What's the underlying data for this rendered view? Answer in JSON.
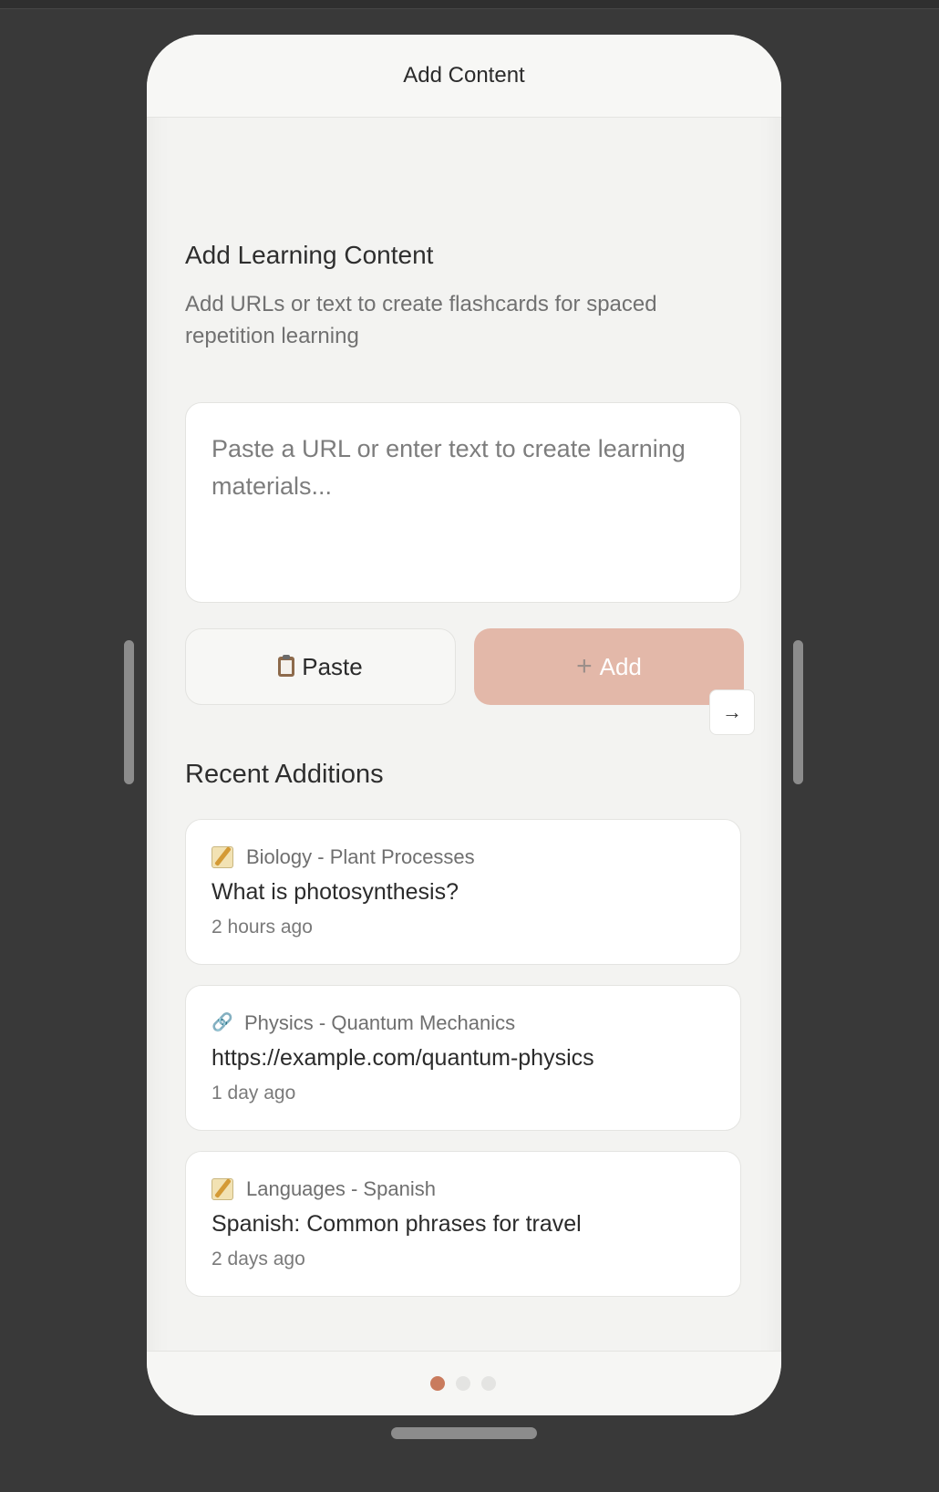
{
  "screen": {
    "header_title": "Add Content"
  },
  "intro": {
    "title": "Add Learning Content",
    "subtitle": "Add URLs or text to create flashcards for spaced repetition learning"
  },
  "input": {
    "placeholder": "Paste a URL or enter text to create learning materials..."
  },
  "actions": {
    "paste_label": "Paste",
    "add_label": "Add",
    "arrow_label": "→"
  },
  "recent": {
    "title": "Recent Additions",
    "items": [
      {
        "type_icon": "memo-icon",
        "category": "Biology - Plant Processes",
        "title": "What is photosynthesis?",
        "time": "2 hours ago"
      },
      {
        "type_icon": "link-icon",
        "category": "Physics - Quantum Mechanics",
        "title": "https://example.com/quantum-physics",
        "time": "1 day ago"
      },
      {
        "type_icon": "memo-icon",
        "category": "Languages - Spanish",
        "title": "Spanish: Common phrases for travel",
        "time": "2 days ago"
      }
    ]
  },
  "pagination": {
    "active_page": 1,
    "total_pages": 3
  },
  "colors": {
    "accent": "#c97b5d",
    "add_button": "#e3b8a9",
    "background": "#393939",
    "surface": "#f3f3f1"
  }
}
